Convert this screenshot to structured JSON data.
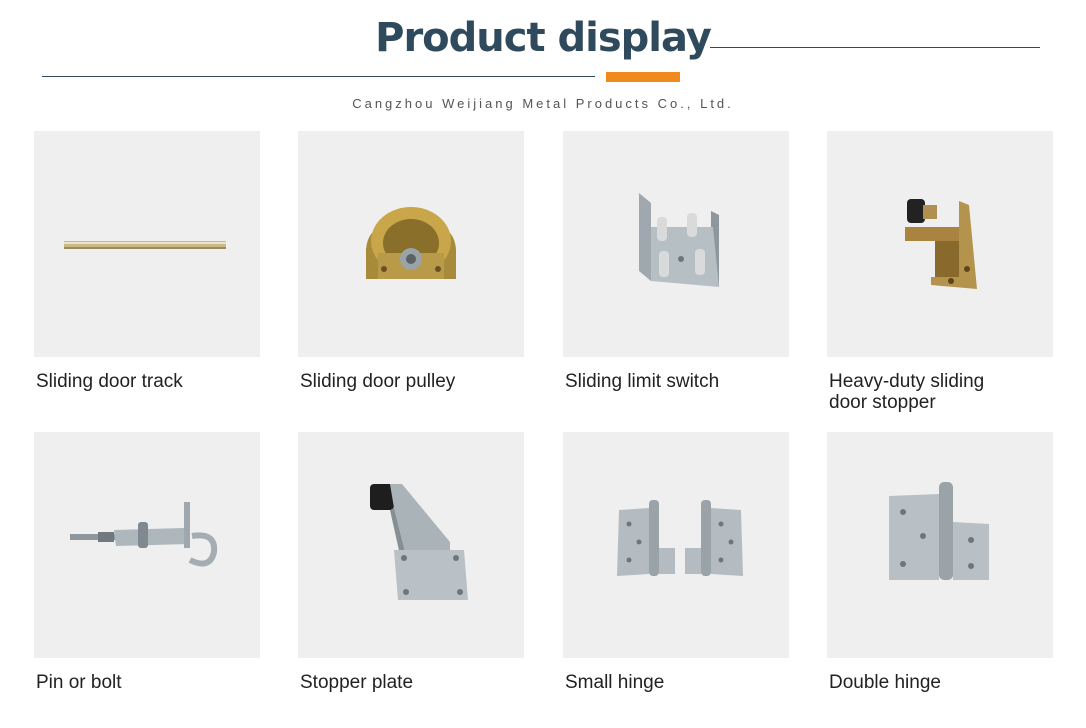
{
  "header": {
    "title": "Product display",
    "company": "Cangzhou Weijiang Metal Products Co., Ltd."
  },
  "colors": {
    "title": "#2e4a5c",
    "accent": "#f08a1c",
    "tile_bg": "#efefef"
  },
  "products": [
    {
      "label": "Sliding door track",
      "icon": "sliding-door-track-image"
    },
    {
      "label": "Sliding door pulley",
      "icon": "sliding-door-pulley-image"
    },
    {
      "label": "Sliding limit switch",
      "icon": "sliding-limit-switch-image"
    },
    {
      "label": "Heavy-duty sliding door stopper",
      "icon": "heavy-duty-door-stopper-image"
    },
    {
      "label": "Pin or bolt",
      "icon": "pin-bolt-image"
    },
    {
      "label": "Stopper plate",
      "icon": "stopper-plate-image"
    },
    {
      "label": "Small hinge",
      "icon": "small-hinge-image"
    },
    {
      "label": "Double hinge",
      "icon": "double-hinge-image"
    }
  ]
}
